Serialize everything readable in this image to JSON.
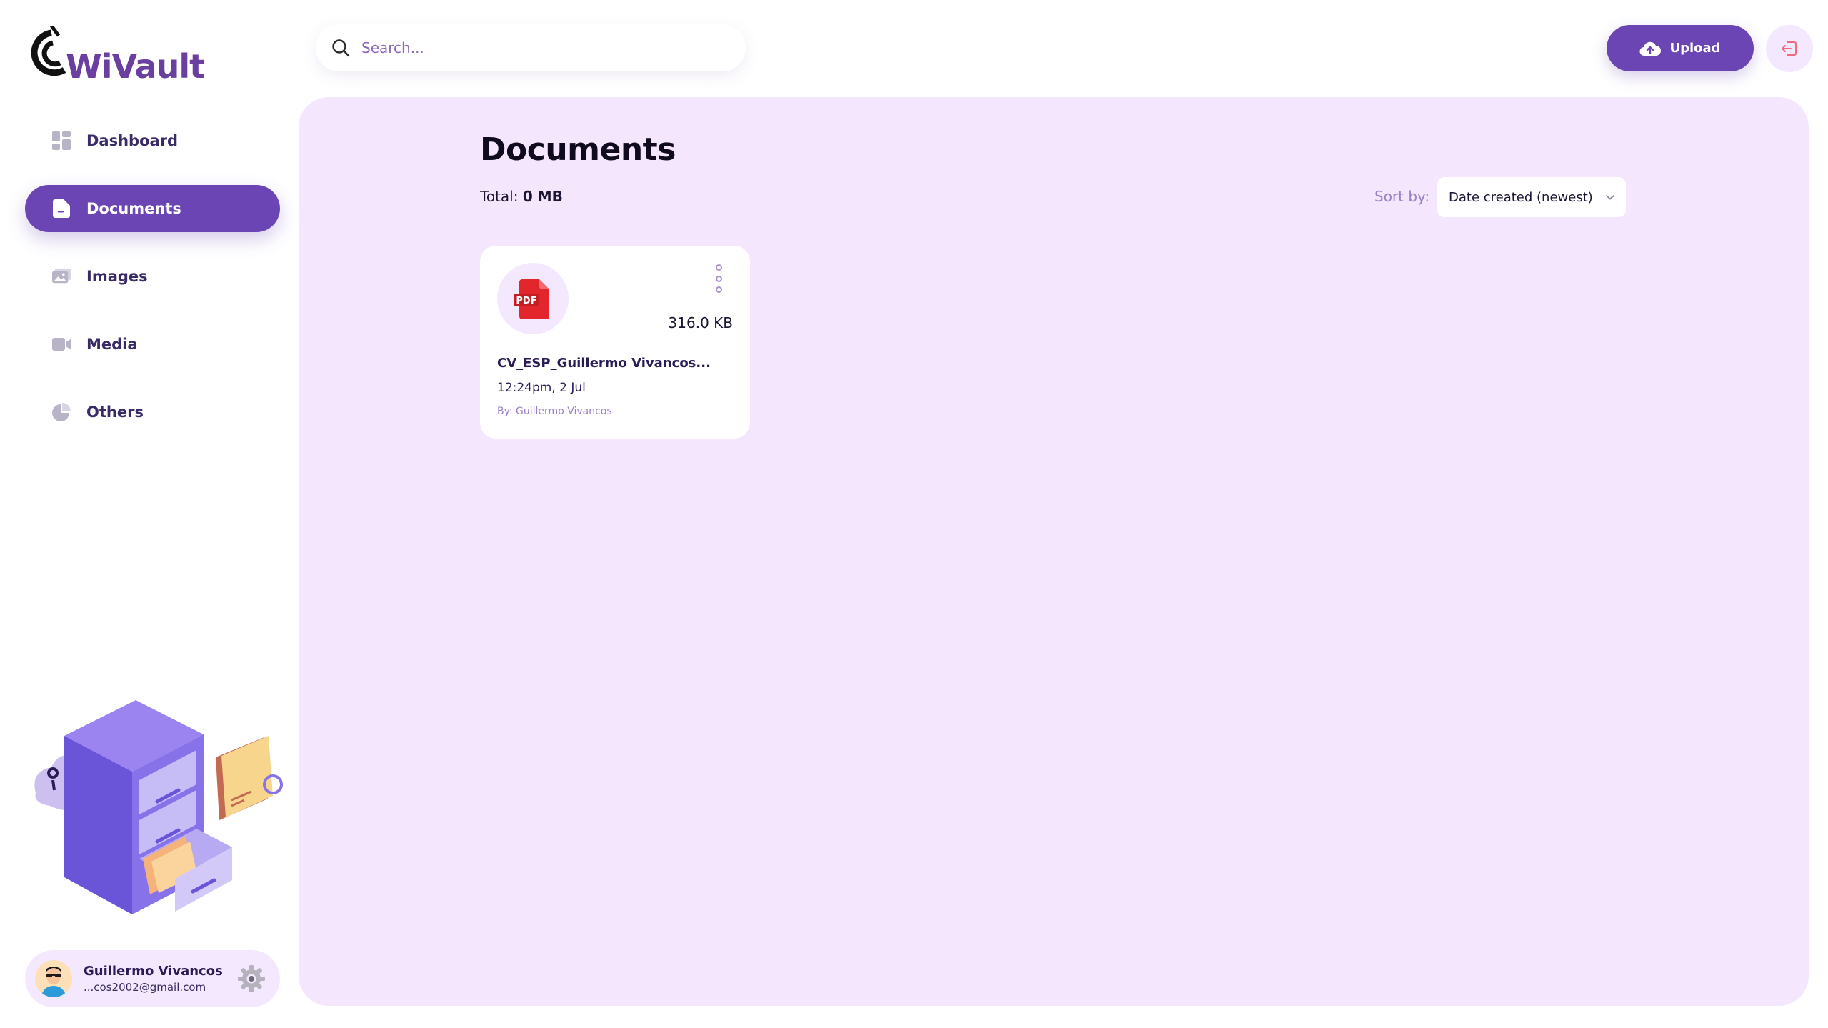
{
  "app": {
    "logo_text": "WiVault"
  },
  "sidebar": {
    "items": [
      {
        "label": "Dashboard",
        "icon": "dashboard-icon",
        "active": false
      },
      {
        "label": "Documents",
        "icon": "document-icon",
        "active": true
      },
      {
        "label": "Images",
        "icon": "image-icon",
        "active": false
      },
      {
        "label": "Media",
        "icon": "video-icon",
        "active": false
      },
      {
        "label": "Others",
        "icon": "pie-chart-icon",
        "active": false
      }
    ]
  },
  "user": {
    "name": "Guillermo Vivancos",
    "email": "...cos2002@gmail.com"
  },
  "header": {
    "search_placeholder": "Search...",
    "upload_label": "Upload"
  },
  "main": {
    "title": "Documents",
    "total_label": "Total:",
    "total_value": "0 MB",
    "sort_label": "Sort by:",
    "sort_value": "Date created (newest)",
    "files": [
      {
        "type_badge": "PDF",
        "size": "316.0 KB",
        "name": "CV_ESP_Guillermo Vivancos...",
        "date": "12:24pm, 2 Jul",
        "owner": "By: Guillermo Vivancos"
      }
    ]
  },
  "colors": {
    "accent": "#6c45b5",
    "main_bg": "#f3e6fd",
    "pdf_red": "#e2262b"
  }
}
